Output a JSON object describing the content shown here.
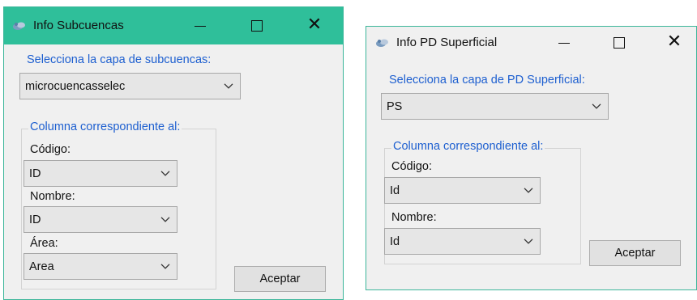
{
  "windows": [
    {
      "title": "Info Subcuencas",
      "layer_label": "Selecciona la capa de subcuencas:",
      "layer_value": "microcuencasselec",
      "group_label": "Columna correspondiente al:",
      "fields": [
        {
          "label": "Código:",
          "value": "ID"
        },
        {
          "label": "Nombre:",
          "value": "ID"
        },
        {
          "label": "Área:",
          "value": "Area"
        }
      ],
      "accept_label": "Aceptar"
    },
    {
      "title": "Info PD Superficial",
      "layer_label": "Selecciona la capa de PD Superficial:",
      "layer_value": "PS",
      "group_label": "Columna correspondiente al:",
      "fields": [
        {
          "label": "Código:",
          "value": "Id"
        },
        {
          "label": "Nombre:",
          "value": "Id"
        }
      ],
      "accept_label": "Aceptar"
    }
  ],
  "colors": {
    "titlebar": "#2fbf9a",
    "label_blue": "#1d5fd0",
    "window_bg": "#f0f0f0"
  },
  "icons": [
    "app-icon",
    "minimize-icon",
    "maximize-icon",
    "close-icon",
    "chevron-down-icon"
  ]
}
